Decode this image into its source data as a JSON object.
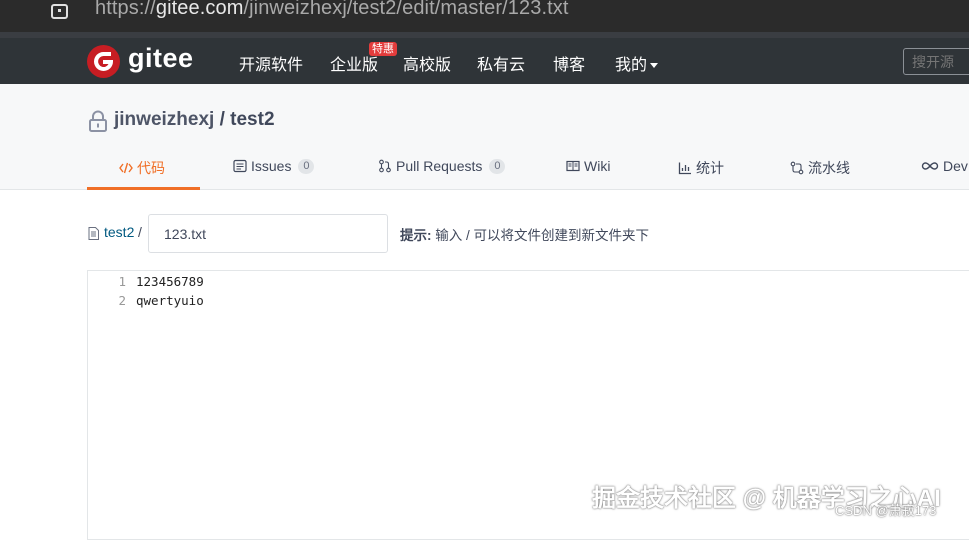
{
  "browser": {
    "url_prefix": "https://",
    "url_host": "gitee.com",
    "url_path": "/jinweizhexj/test2/edit/master/123.txt"
  },
  "header": {
    "brand": "gitee",
    "nav": [
      {
        "label": "开源软件"
      },
      {
        "label": "企业版"
      },
      {
        "label": "高校版"
      },
      {
        "label": "私有云"
      },
      {
        "label": "博客"
      },
      {
        "label": "我的"
      }
    ],
    "hot_badge": "特惠",
    "search_placeholder": "搜开源"
  },
  "project": {
    "owner": "jinweizhexj",
    "separator": " / ",
    "name": "test2",
    "tabs": [
      {
        "label": "代码",
        "icon": "code-icon",
        "active": true
      },
      {
        "label": "Issues",
        "icon": "issues-icon",
        "count": "0"
      },
      {
        "label": "Pull Requests",
        "icon": "pull-request-icon",
        "count": "0"
      },
      {
        "label": "Wiki",
        "icon": "wiki-icon"
      },
      {
        "label": "统计",
        "icon": "stats-icon"
      },
      {
        "label": "流水线",
        "icon": "pipeline-icon"
      },
      {
        "label": "Dev",
        "icon": "devops-icon"
      }
    ]
  },
  "path": {
    "repo": "test2",
    "sep": "/",
    "filename": "123.txt",
    "hint_label": "提示:",
    "hint_text": " 输入 / 可以将文件创建到新文件夹下"
  },
  "editor": {
    "lines": [
      {
        "no": "1",
        "text": "123456789"
      },
      {
        "no": "2",
        "text": "qwertyuio"
      }
    ]
  },
  "watermark": {
    "main": "掘金技术社区 @ 机器学习之心AI",
    "sub": "CSDN @萧寂173"
  },
  "colors": {
    "accent": "#f06f27",
    "brand_red": "#c71d23",
    "header_bg": "#2f3438",
    "link": "#005980"
  }
}
